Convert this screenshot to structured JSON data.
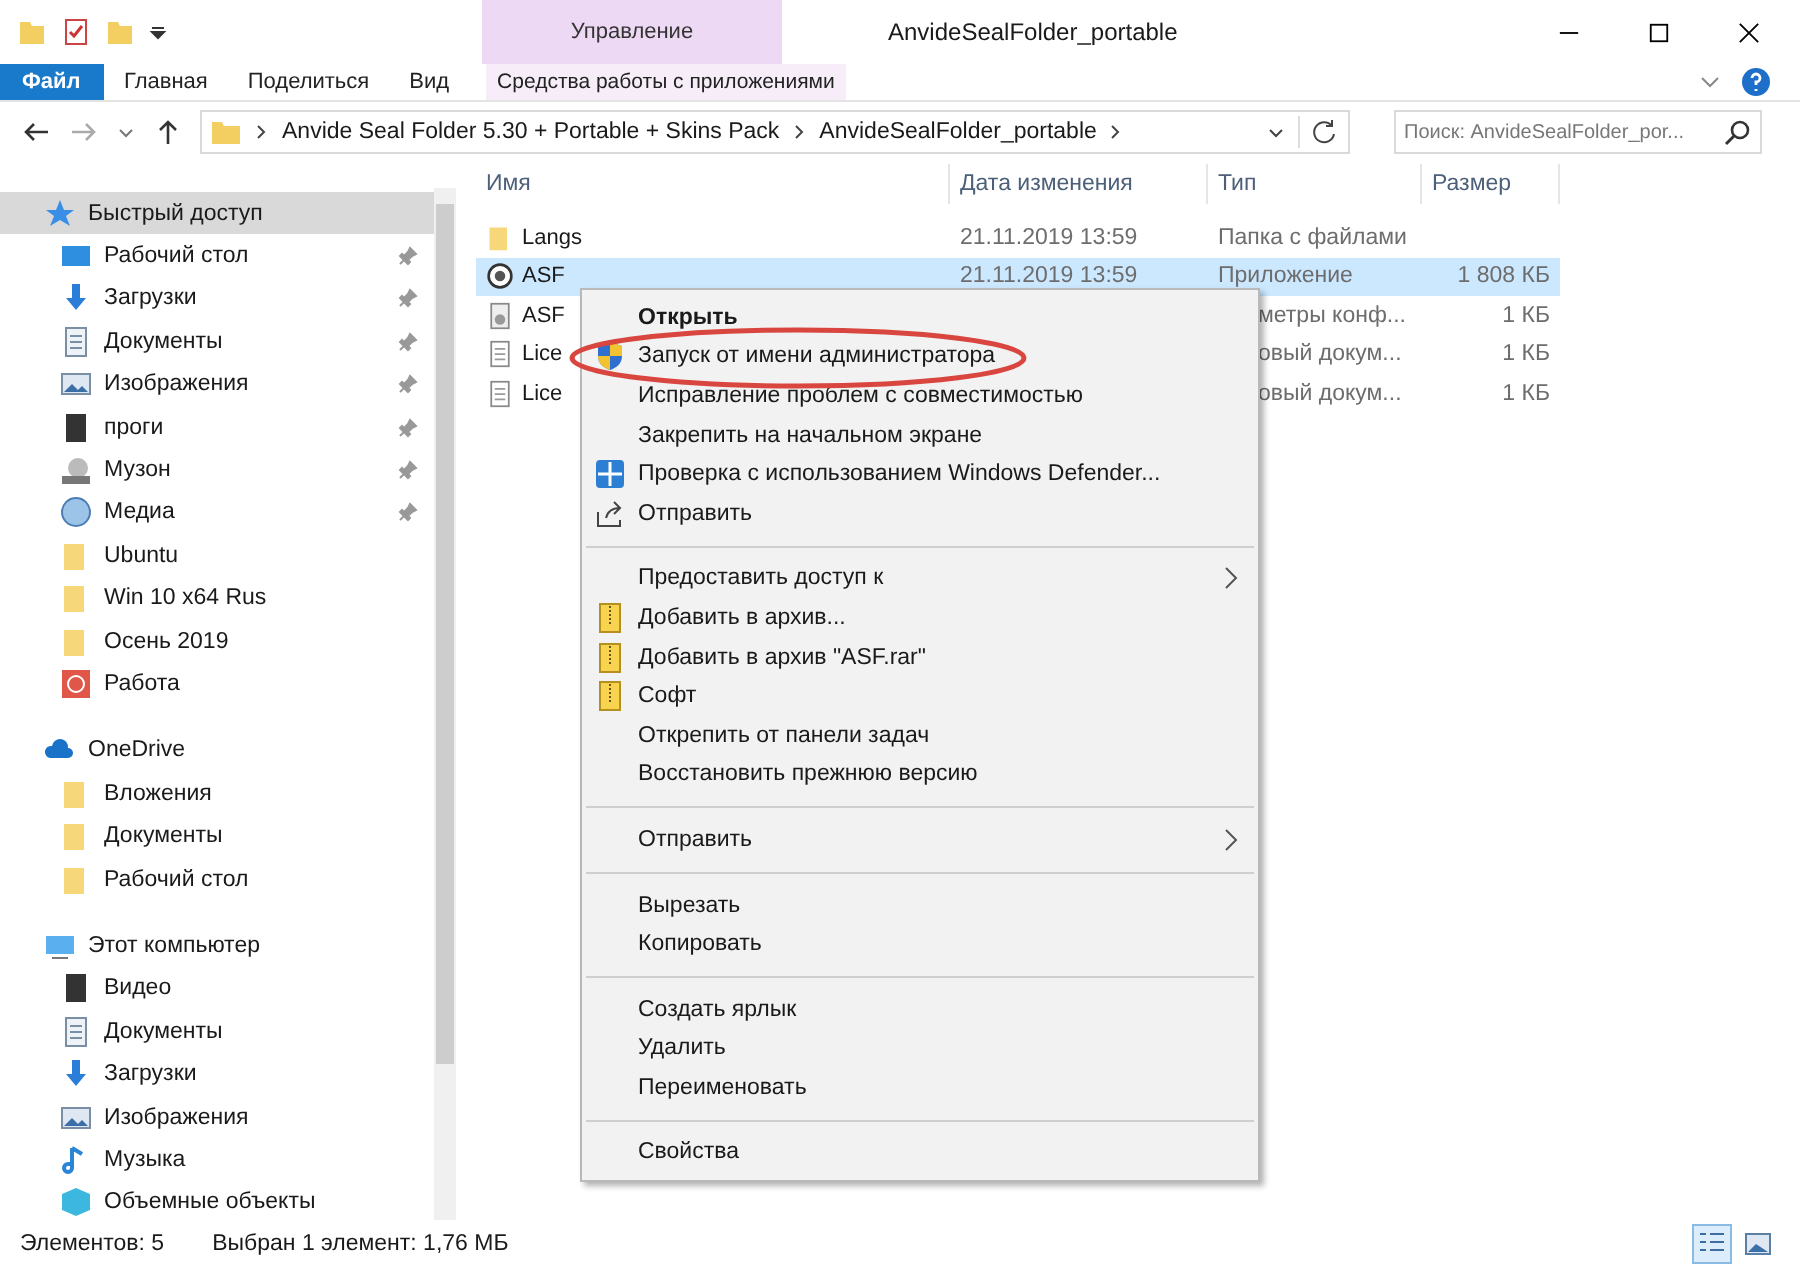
{
  "window": {
    "title": "AnvideSealFolder_portable"
  },
  "context_tab": {
    "header": "Управление",
    "label": "Средства работы с приложениями"
  },
  "ribbon_tabs": [
    {
      "label": "Файл",
      "kind": "file"
    },
    {
      "label": "Главная",
      "kind": "tab"
    },
    {
      "label": "Поделиться",
      "kind": "tab"
    },
    {
      "label": "Вид",
      "kind": "tab"
    }
  ],
  "address": {
    "path": [
      "Anvide Seal Folder 5.30 + Portable + Skins Pack",
      "AnvideSealFolder_portable"
    ],
    "search_placeholder": "Поиск: AnvideSealFolder_por..."
  },
  "sidebar": [
    {
      "label": "Быстрый доступ",
      "selected": true,
      "children": [
        {
          "label": "Рабочий стол",
          "pinned": true
        },
        {
          "label": "Загрузки",
          "pinned": true
        },
        {
          "label": "Документы",
          "pinned": true
        },
        {
          "label": "Изображения",
          "pinned": true
        },
        {
          "label": "проги",
          "pinned": true
        },
        {
          "label": "Музон",
          "pinned": true
        },
        {
          "label": "Медиа",
          "pinned": true
        },
        {
          "label": "Ubuntu",
          "pinned": false
        },
        {
          "label": "Win 10 x64 Rus",
          "pinned": false
        },
        {
          "label": "Осень 2019",
          "pinned": false
        },
        {
          "label": "Работа",
          "pinned": false
        }
      ]
    },
    {
      "label": "OneDrive",
      "selected": false,
      "children": [
        {
          "label": "Вложения",
          "pinned": false
        },
        {
          "label": "Документы",
          "pinned": false
        },
        {
          "label": "Рабочий стол",
          "pinned": false
        }
      ]
    },
    {
      "label": "Этот компьютер",
      "selected": false,
      "children": [
        {
          "label": "Видео",
          "pinned": false
        },
        {
          "label": "Документы",
          "pinned": false
        },
        {
          "label": "Загрузки",
          "pinned": false
        },
        {
          "label": "Изображения",
          "pinned": false
        },
        {
          "label": "Музыка",
          "pinned": false
        },
        {
          "label": "Объемные объекты",
          "pinned": false
        }
      ]
    }
  ],
  "table": {
    "columns": [
      "Имя",
      "Дата изменения",
      "Тип",
      "Размер"
    ],
    "rows": [
      {
        "name": "Langs",
        "date": "21.11.2019 13:59",
        "type": "Папка с файлами",
        "size": "",
        "selected": false
      },
      {
        "name": "ASF",
        "date": "21.11.2019 13:59",
        "type": "Приложение",
        "size": "1 808 КБ",
        "selected": true
      },
      {
        "name": "ASF",
        "date": "",
        "type": "метры конф...",
        "size": "1 КБ",
        "selected": false
      },
      {
        "name": "Lice",
        "date": "",
        "type": "овый докум...",
        "size": "1 КБ",
        "selected": false
      },
      {
        "name": "Lice",
        "date": "",
        "type": "овый докум...",
        "size": "1 КБ",
        "selected": false
      }
    ]
  },
  "context_menu": [
    {
      "kind": "item",
      "label": "Открыть",
      "bold": true
    },
    {
      "kind": "item",
      "label": "Запуск от имени администратора",
      "highlighted": true
    },
    {
      "kind": "item",
      "label": "Исправление проблем с совместимостью"
    },
    {
      "kind": "item",
      "label": "Закрепить на начальном экране"
    },
    {
      "kind": "item",
      "label": "Проверка с использованием Windows Defender..."
    },
    {
      "kind": "item",
      "label": "Отправить"
    },
    {
      "kind": "separator"
    },
    {
      "kind": "submenu",
      "label": "Предоставить доступ к"
    },
    {
      "kind": "item",
      "label": "Добавить в архив..."
    },
    {
      "kind": "item",
      "label": "Добавить в архив \"ASF.rar\""
    },
    {
      "kind": "item",
      "label": "Софт"
    },
    {
      "kind": "item",
      "label": "Открепить от панели задач"
    },
    {
      "kind": "item",
      "label": "Восстановить прежнюю версию"
    },
    {
      "kind": "separator"
    },
    {
      "kind": "submenu",
      "label": "Отправить"
    },
    {
      "kind": "separator"
    },
    {
      "kind": "item",
      "label": "Вырезать"
    },
    {
      "kind": "item",
      "label": "Копировать"
    },
    {
      "kind": "separator"
    },
    {
      "kind": "item",
      "label": "Создать ярлык"
    },
    {
      "kind": "item",
      "label": "Удалить"
    },
    {
      "kind": "item",
      "label": "Переименовать"
    },
    {
      "kind": "separator"
    },
    {
      "kind": "item",
      "label": "Свойства"
    }
  ],
  "status_bar": {
    "count": "Элементов: 5",
    "selection": "Выбран 1 элемент: 1,76 МБ"
  }
}
